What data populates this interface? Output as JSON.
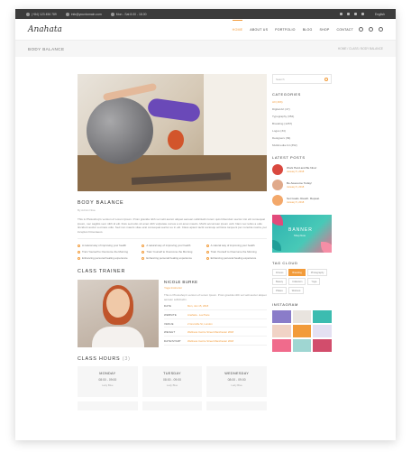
{
  "topbar": {
    "phone": "(+84) 123 456 789",
    "email": "info@yourdomain.com",
    "address": "Mon - Sat 8.00 - 18.00",
    "language": "English"
  },
  "header": {
    "logo": "Anahata",
    "nav": [
      "HOME",
      "ABOUT US",
      "PORTFOLIO",
      "BLOG",
      "SHOP",
      "CONTACT"
    ]
  },
  "titlebar": {
    "title": "BODY BALANCE",
    "breadcrumb": "HOME / CLASS / BODY BALANCE"
  },
  "article": {
    "title": "BODY BALANCE",
    "meta": "By Admin Nisa",
    "text": "This is Photoshop's version of Lorem Ipsum. Proin gravida nibh vel velit auctor aliquet aenean sollicitudin lorem quis bibendum auctor nisi elit consequat ipsum, nec sagittis sem nibh id elit. Duis sed odio sit amet nibh vulputate cursus a sit amet mauris. Morbi accumsan ipsum velit. Nam nec tellus a odio tincidunt auctor a ornare odio. Sed non mauris vitae erat consequat auctor eu in elit. Class aptent taciti sociosqu ad litora torquent per conubia nostra, per inceptos himenaeos.",
    "features": [
      "A natural way of improving your health",
      "A natural way of improving your health",
      "A natural way of improving your health",
      "Train Yourself to Overcome the Morning",
      "Train Yourself to Overcome the Morning",
      "Train Yourself to Overcome the Morning",
      "Enhancing personal healing experience",
      "Enhancing personal healing experience",
      "Enhancing personal healing experience"
    ]
  },
  "trainer": {
    "heading": "CLASS TRAINER",
    "name": "NICOLE BURKE",
    "role": "Yoga Instructor",
    "desc": "This is Photoshop's version of Lorem Ipsum. Proin gravida nibh vel velit auctor aliquet aenean sollicitudin.",
    "rows": [
      {
        "k": "DATE",
        "v": "Mon, Jan 15, 2018"
      },
      {
        "k": "WEBSITE",
        "v": "Anahata - LeeTrace"
      },
      {
        "k": "VENUE",
        "v": "2 Grenville St, London"
      },
      {
        "k": "WEIGHT",
        "v": "Wellness Centre Street Manchester 2018"
      },
      {
        "k": "DATE/START",
        "v": "Wellness Centre Street Manchester 2018"
      }
    ]
  },
  "hours": {
    "heading": "CLASS HOURS",
    "count": "(3)",
    "cards": [
      {
        "day": "MONDAY",
        "time": "08:00 - 09:00",
        "loc": "Lady Blue"
      },
      {
        "day": "TUESDAY",
        "time": "08:00 - 09:00",
        "loc": "Lady Blue"
      },
      {
        "day": "WEDNESDAY",
        "time": "08:00 - 09:00",
        "loc": "Lady Blue"
      }
    ]
  },
  "sidebar": {
    "search_placeholder": "Search",
    "categories_title": "CATEGORIES",
    "categories": [
      "All (163)",
      "Digital Art (47)",
      "Typography (352)",
      "Branding (1267)",
      "Logos (34)",
      "Designers (39)",
      "Multimedia Art (352)"
    ],
    "latest_title": "LATEST POSTS",
    "posts": [
      {
        "title": "Work Hard and Be Nice!",
        "date": "January 5, 2018"
      },
      {
        "title": "Be Awesome Today!",
        "date": "January 5, 2018"
      },
      {
        "title": "Set Goals. Reach. Repeat.",
        "date": "January 5, 2018"
      }
    ],
    "banner_title": "BANNER",
    "banner_sub": "Shop Now",
    "tags_title": "TAG CLOUD",
    "tags": [
      "Fitness",
      "Branding",
      "Photography",
      "Beauty",
      "Collection",
      "Yoga",
      "Pilates",
      "Workout"
    ],
    "instagram_title": "INSTAGRAM"
  },
  "colors": {
    "accent": "#f29b3a",
    "topbar": "#3c3c3c"
  }
}
